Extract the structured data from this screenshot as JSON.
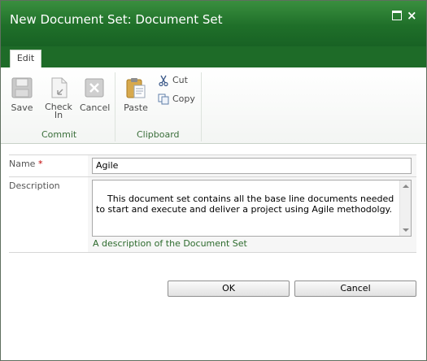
{
  "window": {
    "title": "New Document Set: Document Set",
    "maximize_icon": "maximize-icon",
    "close_icon": "close-icon",
    "close_glyph": "×"
  },
  "ribbon": {
    "tabs": [
      {
        "label": "Edit",
        "selected": true
      }
    ],
    "groups": {
      "commit": {
        "label": "Commit",
        "buttons": [
          {
            "label": "Save",
            "icon": "floppy-disk-icon",
            "enabled": false
          },
          {
            "label": "Check In",
            "icon": "check-in-icon",
            "enabled": false
          },
          {
            "label": "Cancel",
            "icon": "cancel-icon",
            "enabled": false
          }
        ]
      },
      "clipboard": {
        "label": "Clipboard",
        "paste": {
          "label": "Paste",
          "icon": "paste-icon"
        },
        "cut": {
          "label": "Cut",
          "icon": "scissors-icon"
        },
        "copy": {
          "label": "Copy",
          "icon": "copy-icon"
        }
      }
    }
  },
  "form": {
    "name": {
      "label": "Name",
      "required_mark": "*",
      "value": "Agile"
    },
    "description": {
      "label": "Description",
      "value": "This document set contains all the base line documents needed to start and execute and deliver a project using Agile methodolgy.",
      "hint": "A description of the Document Set"
    }
  },
  "buttons": {
    "ok": "OK",
    "cancel": "Cancel"
  },
  "colors": {
    "titlebar": "#1f6f29",
    "accent_text": "#2d6b2d",
    "required": "#bf0000"
  }
}
